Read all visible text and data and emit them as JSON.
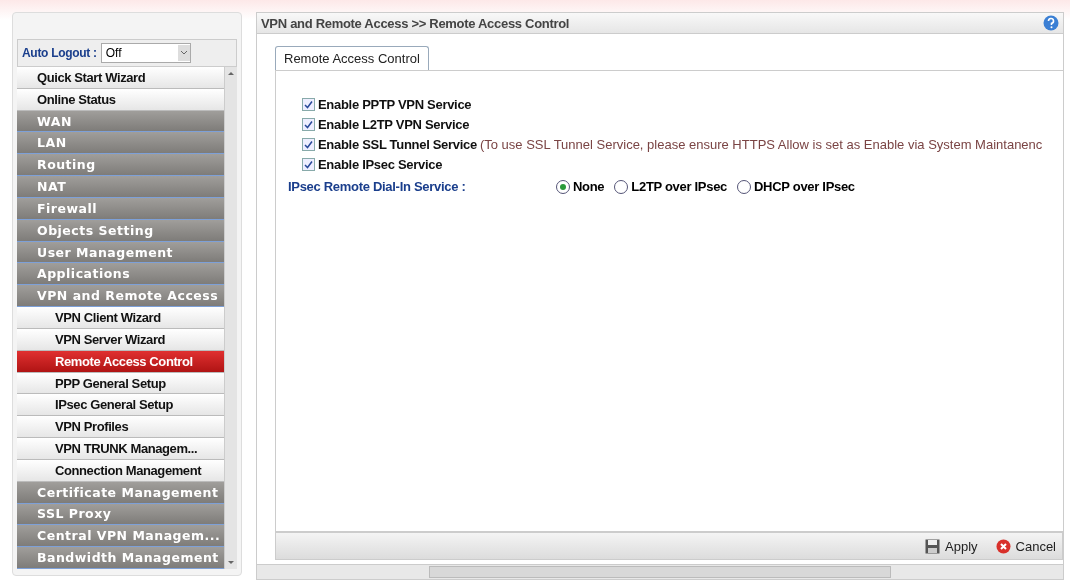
{
  "auto_logout": {
    "label": "Auto Logout",
    "separator": ":",
    "value": "Off"
  },
  "menu": [
    {
      "label": "Quick Start Wizard",
      "kind": "top",
      "selected": false
    },
    {
      "label": "Online Status",
      "kind": "top",
      "selected": false
    },
    {
      "label": "WAN",
      "kind": "group",
      "selected": false
    },
    {
      "label": "LAN",
      "kind": "group",
      "selected": false
    },
    {
      "label": "Routing",
      "kind": "group",
      "selected": false
    },
    {
      "label": "NAT",
      "kind": "group",
      "selected": false
    },
    {
      "label": "Firewall",
      "kind": "group",
      "selected": false
    },
    {
      "label": "Objects Setting",
      "kind": "group",
      "selected": false
    },
    {
      "label": "User Management",
      "kind": "group",
      "selected": false
    },
    {
      "label": "Applications",
      "kind": "group",
      "selected": false
    },
    {
      "label": "VPN and Remote Access",
      "kind": "group",
      "selected": false
    },
    {
      "label": "VPN Client Wizard",
      "kind": "sub",
      "selected": false
    },
    {
      "label": "VPN Server Wizard",
      "kind": "sub",
      "selected": false
    },
    {
      "label": "Remote Access Control",
      "kind": "sub",
      "selected": true
    },
    {
      "label": "PPP General Setup",
      "kind": "sub",
      "selected": false
    },
    {
      "label": "IPsec General Setup",
      "kind": "sub",
      "selected": false
    },
    {
      "label": "VPN Profiles",
      "kind": "sub",
      "selected": false
    },
    {
      "label": "VPN TRUNK Managem...",
      "kind": "sub",
      "selected": false
    },
    {
      "label": "Connection Management",
      "kind": "sub",
      "selected": false
    },
    {
      "label": "Certificate Management",
      "kind": "group",
      "selected": false
    },
    {
      "label": "SSL Proxy",
      "kind": "group",
      "selected": false
    },
    {
      "label": "Central VPN Managem...",
      "kind": "group",
      "selected": false
    },
    {
      "label": "Bandwidth Management",
      "kind": "group",
      "selected": false
    }
  ],
  "breadcrumb": "VPN and Remote Access >> Remote Access Control",
  "tabs": [
    {
      "label": "Remote Access Control",
      "selected": true
    }
  ],
  "services": [
    {
      "label": "Enable PPTP VPN Service",
      "checked": true
    },
    {
      "label": "Enable L2TP VPN Service",
      "checked": true
    },
    {
      "label": "Enable SSL Tunnel Service",
      "checked": true,
      "note": "(To use SSL Tunnel Service, please ensure HTTPS Allow is set as Enable via System Maintanenc"
    },
    {
      "label": "Enable IPsec Service",
      "checked": true
    }
  ],
  "dial_in": {
    "label": "IPsec Remote Dial-In Service :",
    "options": [
      {
        "label": "None",
        "selected": true
      },
      {
        "label": "L2TP over IPsec",
        "selected": false
      },
      {
        "label": "DHCP over IPsec",
        "selected": false
      }
    ]
  },
  "buttons": [
    {
      "label": "Apply",
      "kind": "apply"
    },
    {
      "label": "Cancel",
      "kind": "cancel"
    }
  ]
}
